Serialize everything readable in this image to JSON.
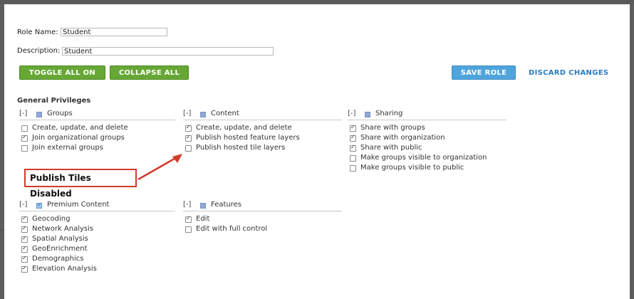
{
  "form": {
    "role_name_label": "Role Name:",
    "role_name_value": "Student",
    "description_label": "Description:",
    "description_value": "Student"
  },
  "toolbar": {
    "toggle_all_on": "TOGGLE ALL ON",
    "collapse_all": "COLLAPSE ALL",
    "save_role": "SAVE ROLE",
    "discard_changes": "DISCARD CHANGES"
  },
  "colors": {
    "green_button": "#66a735",
    "blue_button": "#4fa4dc",
    "link": "#2a7cc1",
    "callout_border": "#d23b2c"
  },
  "general_privileges": {
    "title": "General Privileges",
    "groups": {
      "toggle": "[-]",
      "title": "Groups",
      "items": [
        {
          "label": "Create, update, and delete",
          "checked": false
        },
        {
          "label": "Join organizational groups",
          "checked": true
        },
        {
          "label": "Join external groups",
          "checked": false
        }
      ]
    },
    "content": {
      "toggle": "[-]",
      "title": "Content",
      "items": [
        {
          "label": "Create, update, and delete",
          "checked": true
        },
        {
          "label": "Publish hosted feature layers",
          "checked": true
        },
        {
          "label": "Publish hosted tile layers",
          "checked": false
        }
      ]
    },
    "sharing": {
      "toggle": "[-]",
      "title": "Sharing",
      "items": [
        {
          "label": "Share with groups",
          "checked": true
        },
        {
          "label": "Share with organization",
          "checked": true
        },
        {
          "label": "Share with public",
          "checked": true
        },
        {
          "label": "Make groups visible to organization",
          "checked": false
        },
        {
          "label": "Make groups visible to public",
          "checked": false
        }
      ]
    }
  },
  "premium_content": {
    "toggle": "[-]",
    "title": "Premium Content",
    "items": [
      {
        "label": "Geocoding",
        "checked": true
      },
      {
        "label": "Network Analysis",
        "checked": true
      },
      {
        "label": "Spatial Analysis",
        "checked": true
      },
      {
        "label": "GeoEnrichment",
        "checked": true
      },
      {
        "label": "Demographics",
        "checked": true
      },
      {
        "label": "Elevation Analysis",
        "checked": true
      }
    ]
  },
  "features": {
    "toggle": "[-]",
    "title": "Features",
    "items": [
      {
        "label": "Edit",
        "checked": true
      },
      {
        "label": "Edit with full control",
        "checked": false
      }
    ]
  },
  "callout": {
    "text": "Publish Tiles Disabled"
  },
  "icons": {
    "checkbox_check": "check-icon",
    "arrow": "red-arrow-icon"
  }
}
